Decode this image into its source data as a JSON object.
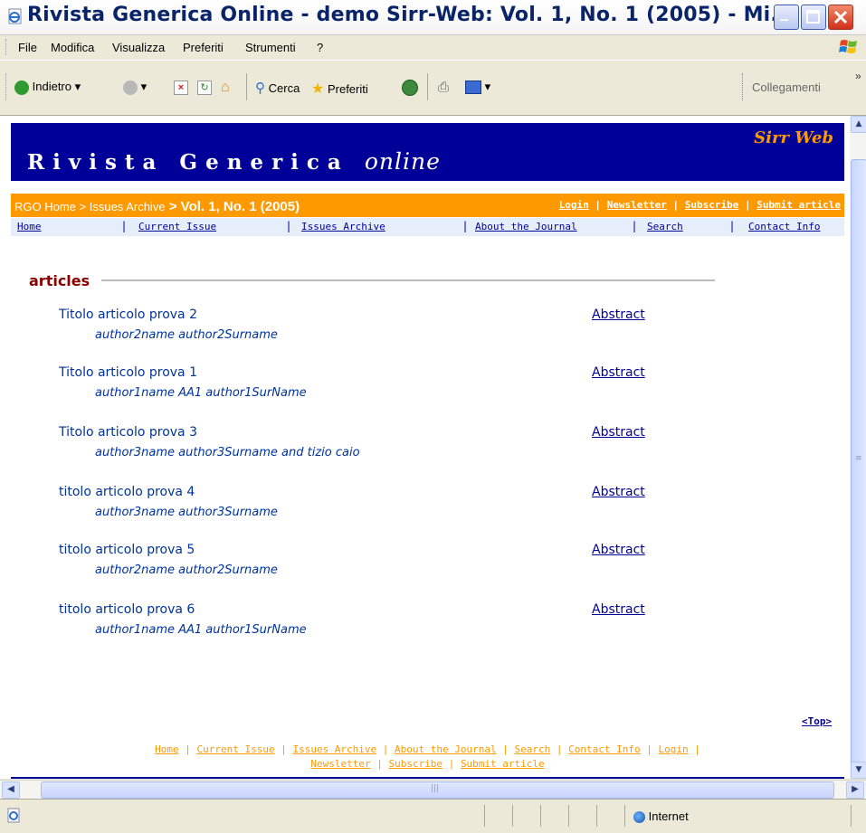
{
  "window": {
    "title": "Rivista Generica Online - demo Sirr-Web:  Vol. 1, No. 1 (2005) - Mi..."
  },
  "menu": {
    "items": [
      "File",
      "Modifica",
      "Visualizza",
      "Preferiti",
      "Strumenti",
      "?"
    ]
  },
  "toolbar": {
    "back_label": "Indietro",
    "search_label": "Cerca",
    "favorites_label": "Preferiti",
    "links_label": "Collegamenti"
  },
  "site": {
    "brand": "Rivista Generica",
    "brand_em": "online",
    "tagline": "Sirr Web"
  },
  "breadcrumb": {
    "home": "RGO Home",
    "sep1": " > ",
    "archive": "Issues Archive",
    "sep2": " > ",
    "current": "Vol. 1, No. 1 (2005)"
  },
  "actions": [
    "Login",
    "Newsletter",
    "Subscribe",
    "Submit article"
  ],
  "nav": [
    "Home",
    "Current Issue",
    "Issues Archive",
    "About the Journal",
    "Search",
    "Contact Info"
  ],
  "section_title": "articles",
  "articles": [
    {
      "title": "Titolo articolo prova 2",
      "authors": "author2name author2Surname",
      "link": "Abstract"
    },
    {
      "title": "Titolo articolo prova 1",
      "authors": "author1name AA1 author1SurName",
      "link": "Abstract"
    },
    {
      "title": "Titolo articolo prova 3",
      "authors": "author3name author3Surname and tizio caio",
      "link": "Abstract"
    },
    {
      "title": "titolo articolo prova 4",
      "authors": "author3name author3Surname",
      "link": "Abstract"
    },
    {
      "title": "titolo articolo prova 5",
      "authors": "author2name author2Surname",
      "link": "Abstract"
    },
    {
      "title": "titolo articolo prova 6",
      "authors": "author1name AA1 author1SurName",
      "link": "Abstract"
    }
  ],
  "top_link": "<Top>",
  "footer": {
    "line1": [
      "Home",
      "Current Issue",
      "Issues Archive",
      "About the Journal",
      "Search",
      "Contact Info",
      "Login"
    ],
    "line2": [
      "Newsletter",
      "Subscribe",
      "Submit article"
    ]
  },
  "status": {
    "zone": "Internet"
  },
  "colors": {
    "header_bg": "#000099",
    "bar_orange": "#ff9900",
    "section_red": "#8b0000",
    "link_blue": "#003399"
  }
}
